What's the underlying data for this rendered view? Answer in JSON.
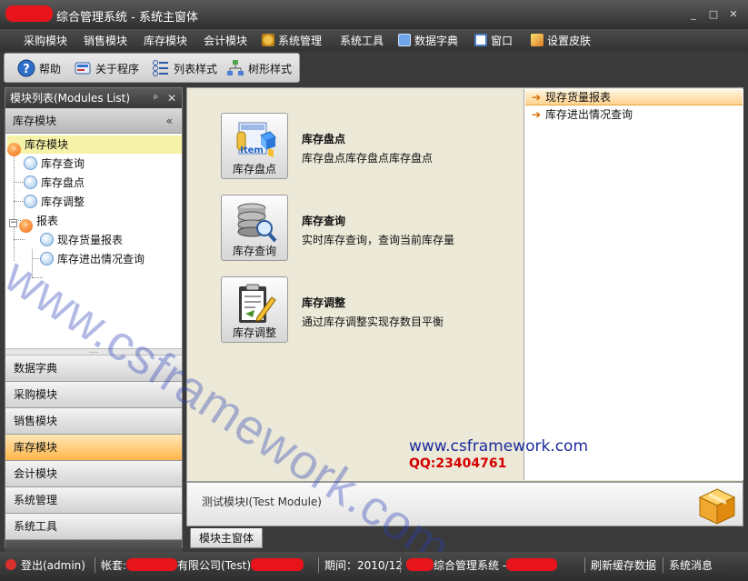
{
  "window": {
    "title": "综合管理系统 - 系统主窗体",
    "controls": [
      "_",
      "□",
      "✕"
    ]
  },
  "menu": [
    {
      "label": "采购模块",
      "icon": ""
    },
    {
      "label": "销售模块",
      "icon": ""
    },
    {
      "label": "库存模块",
      "icon": ""
    },
    {
      "label": "会计模块",
      "icon": ""
    },
    {
      "label": "系统管理",
      "icon": "gears-icon"
    },
    {
      "label": "系统工具",
      "icon": ""
    },
    {
      "label": "数据字典",
      "icon": "dictionary-icon"
    },
    {
      "label": "窗口",
      "icon": "window-icon"
    },
    {
      "label": "设置皮肤",
      "icon": "skin-icon"
    }
  ],
  "toolbar": {
    "help": "帮助",
    "about": "关于程序",
    "list_style": "列表样式",
    "tree_style": "树形样式"
  },
  "left_panel": {
    "title": "模块列表(Modules List)",
    "pin": "ᵖ",
    "close": "✕",
    "group_title": "库存模块",
    "collapse": "«",
    "tree": {
      "root": "库存模块",
      "items": [
        "库存查询",
        "库存盘点",
        "库存调整"
      ],
      "reports_folder": "报表",
      "reports": [
        "现存货量报表",
        "库存进出情况查询"
      ]
    },
    "nav": [
      {
        "label": "数据字典",
        "active": false
      },
      {
        "label": "采购模块",
        "active": false
      },
      {
        "label": "销售模块",
        "active": false
      },
      {
        "label": "库存模块",
        "active": true
      },
      {
        "label": "会计模块",
        "active": false
      },
      {
        "label": "系统管理",
        "active": false
      },
      {
        "label": "系统工具",
        "active": false
      }
    ],
    "footer_icon": "⌄"
  },
  "main": {
    "commands": [
      {
        "caption": "库存盘点",
        "title": "库存盘点",
        "desc": "库存盘点库存盘点库存盘点",
        "icon": "inventory-count-icon",
        "icon_text": "Item"
      },
      {
        "caption": "库存查询",
        "title": "库存查询",
        "desc": "实时库存查询，查询当前库存量",
        "icon": "database-search-icon"
      },
      {
        "caption": "库存调整",
        "title": "库存调整",
        "desc": "通过库存调整实现存数目平衡",
        "icon": "clipboard-edit-icon"
      }
    ],
    "reports": [
      "现存货量报表",
      "库存进出情况查询"
    ],
    "watermark": "www.csframework.com",
    "url": "www.csframework.com",
    "qq": "QQ:23404761"
  },
  "test_module": {
    "label": "测试模块I(Test Module)"
  },
  "tabs": [
    "模块主窗体"
  ],
  "status": {
    "logout": "登出(admin)",
    "account_prefix": "帐套:",
    "account_suffix": "有限公司(Test)",
    "period": "期间：2010/12",
    "system": "综合管理系统 -",
    "refresh": "刷新缓存数据",
    "messages": "系统消息"
  },
  "colors": {
    "accent": "#ffb64a",
    "redaction": "#e8141c",
    "selected_tree": "#f6f2a8"
  }
}
